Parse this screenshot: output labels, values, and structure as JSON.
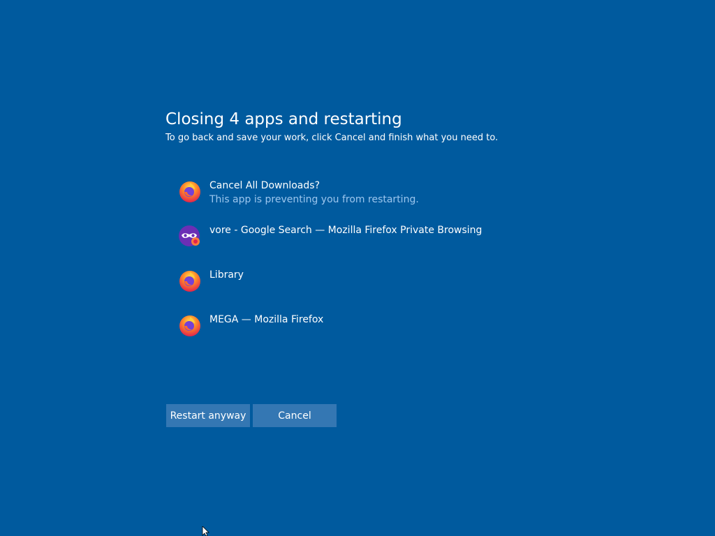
{
  "dialog": {
    "title": "Closing 4 apps and restarting",
    "subtitle": "To go back and save your work, click Cancel and finish what you need to."
  },
  "apps": [
    {
      "name": "Cancel All Downloads?",
      "note": "This app is preventing you from restarting.",
      "icon": "firefox-icon"
    },
    {
      "name": "vore - Google Search — Mozilla Firefox Private Browsing",
      "note": "",
      "icon": "firefox-private-icon"
    },
    {
      "name": "Library",
      "note": "",
      "icon": "firefox-icon"
    },
    {
      "name": "MEGA — Mozilla Firefox",
      "note": "",
      "icon": "firefox-icon"
    }
  ],
  "buttons": {
    "restart_label": "Restart anyway",
    "cancel_label": "Cancel"
  },
  "colors": {
    "background": "#005a9e",
    "button": "#3477b3",
    "note_text": "#9cc6ee"
  }
}
